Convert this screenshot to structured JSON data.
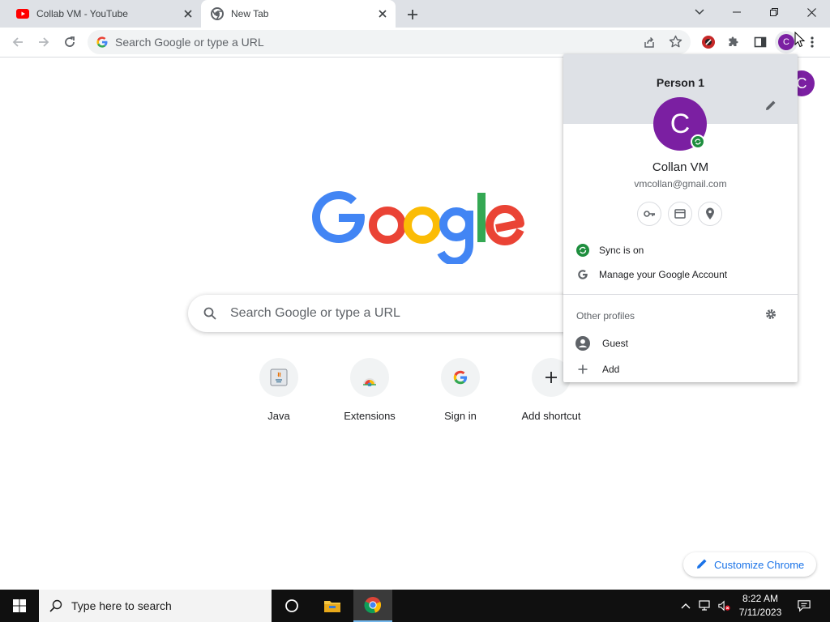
{
  "tabs": [
    {
      "title": "Collab VM - YouTube",
      "favicon": "youtube-icon"
    },
    {
      "title": "New Tab",
      "favicon": "chrome-icon"
    }
  ],
  "omnibox": {
    "placeholder": "Search Google or type a URL"
  },
  "toolbar": {
    "profile_initial": "C"
  },
  "ntp": {
    "avatar_initial": "C",
    "search_placeholder": "Search Google or type a URL",
    "shortcuts": [
      {
        "label": "Java",
        "icon": "java-icon"
      },
      {
        "label": "Extensions",
        "icon": "chrome-web-store-icon"
      },
      {
        "label": "Sign in",
        "icon": "google-g-icon"
      },
      {
        "label": "Add shortcut",
        "icon": "plus-icon"
      }
    ],
    "customize_label": "Customize Chrome"
  },
  "profile_menu": {
    "header_title": "Person 1",
    "avatar_initial": "C",
    "name": "Collan VM",
    "email": "vmcollan@gmail.com",
    "sync_label": "Sync is on",
    "manage_label": "Manage your Google Account",
    "other_profiles_label": "Other profiles",
    "guest_label": "Guest",
    "add_label": "Add"
  },
  "taskbar": {
    "search_placeholder": "Type here to search",
    "time": "8:22 AM",
    "date": "7/11/2023"
  },
  "colors": {
    "avatar": "#7b1fa2",
    "sync_green": "#1e8e3e",
    "link_blue": "#1a73e8"
  }
}
